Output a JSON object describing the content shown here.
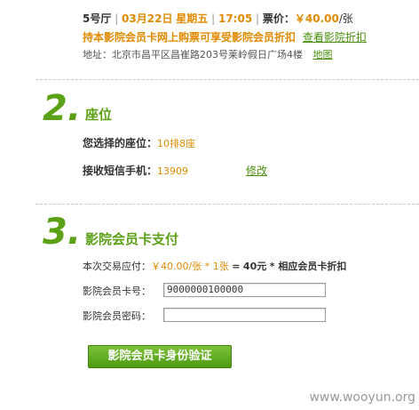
{
  "ticket": {
    "hall": "5号厅",
    "date": "03月22日",
    "weekday": "星期五",
    "time": "17:05",
    "price_label": "票价：",
    "price": "￥40.00",
    "price_unit": "/张",
    "promo": "持本影院会员卡网上购票可享受影院会员折扣",
    "promo_link": "查看影院折扣",
    "address": "地址：北京市昌平区昌崔路203号莱岭假日广场4楼",
    "map_link": "地图"
  },
  "step2": {
    "number": "2.",
    "title": "座位",
    "seat_label": "您选择的座位：",
    "seat_value": "10排8座",
    "phone_label": "接收短信手机：",
    "phone_value": "13909",
    "edit_link": "修改"
  },
  "step3": {
    "number": "3.",
    "title": "影院会员卡支付",
    "amount_label": "本次交易应付：",
    "amount_price": "￥40.00/张 * 1张",
    "amount_eq": "=",
    "amount_total": "40元",
    "amount_suffix": "* 相应会员卡折扣",
    "card_label": "影院会员卡号：",
    "card_value": "9000000100000",
    "password_label": "影院会员密码：",
    "password_value": "",
    "verify_button": "影院会员卡身份验证"
  },
  "watermark": "www.wooyun.org"
}
